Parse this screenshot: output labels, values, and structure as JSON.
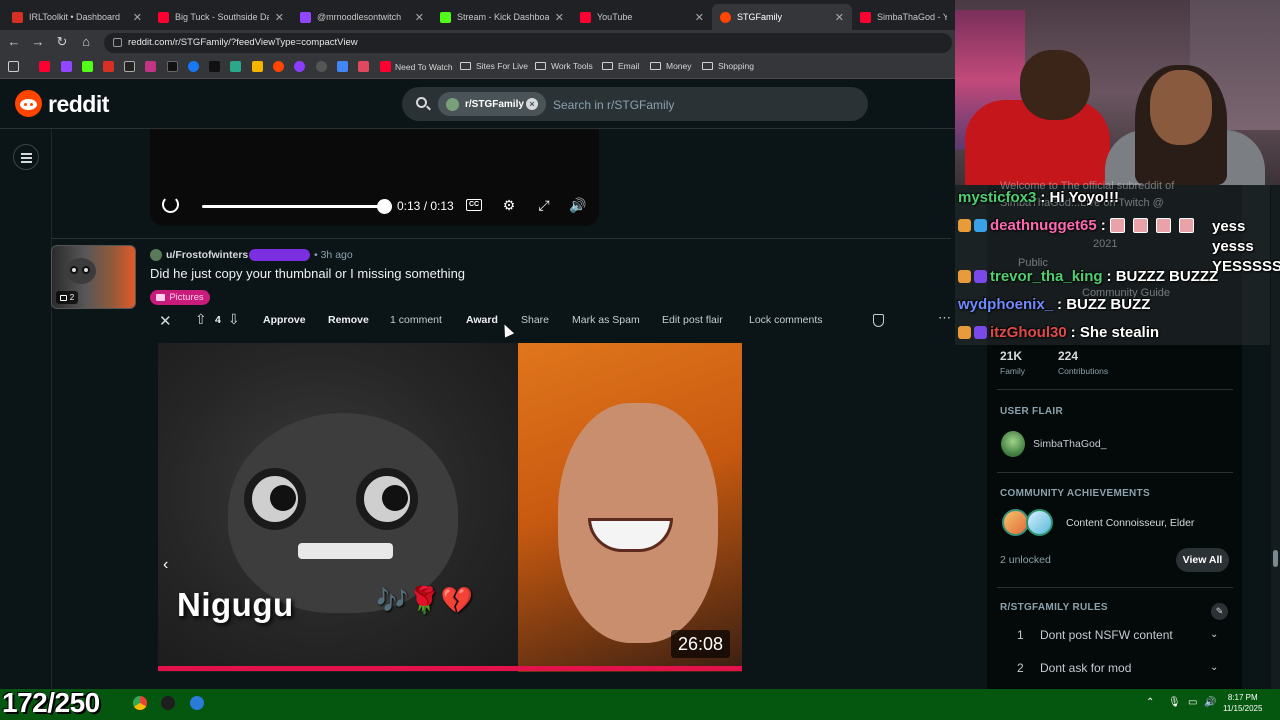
{
  "browser": {
    "tabs": [
      {
        "label": "IRLToolkit • Dashboard",
        "color": "#d93025"
      },
      {
        "label": "Big Tuck - Southside Da Rea",
        "color": "#ff0033"
      },
      {
        "label": "@mrnoodlesontwitch",
        "color": "#9146ff"
      },
      {
        "label": "Stream - Kick Dashboard",
        "color": "#53fc18"
      },
      {
        "label": "YouTube",
        "color": "#ff0033"
      },
      {
        "label": "STGFamily",
        "color": "#ff4500"
      },
      {
        "label": "SimbaThaGod - YouTube",
        "color": "#ff0033"
      }
    ],
    "url": "reddit.com/r/STGFamily/?feedViewType=compactView",
    "bookmarks": {
      "folders": [
        "Need To Watch",
        "Sites For Live",
        "Work Tools",
        "Email",
        "Money",
        "Shopping"
      ]
    }
  },
  "reddit": {
    "wordmark": "reddit",
    "search_chip": "r/STGFamily",
    "search_placeholder": "Search in r/STGFamily"
  },
  "player": {
    "time": "0:13 / 0:13",
    "progress_fraction": 1.0,
    "cc_label": "CC"
  },
  "post": {
    "username": "u/Frostofwinters",
    "user_flair": "",
    "time": "• 3h ago",
    "title": "Did he just copy your thumbnail or I missing something",
    "flair": "Pictures",
    "gallery_count": "2",
    "score": "4",
    "actions": {
      "approve": "Approve",
      "remove": "Remove",
      "comments": "1 comment",
      "award": "Award",
      "share": "Share",
      "spam": "Mark as Spam",
      "edit_flair": "Edit post flair",
      "lock": "Lock comments"
    },
    "image_text": "Nigugu",
    "image_emojis": "🎶🌹💔",
    "image_duration": "26:08"
  },
  "sidebar": {
    "family_count": "21K",
    "family_label": "Family",
    "contrib_count": "224",
    "contrib_label": "Contributions",
    "user_flair_head": "USER FLAIR",
    "user_flair_name": "SimbaThaGod_",
    "achievements_head": "COMMUNITY ACHIEVEMENTS",
    "achievements_text": "Content Connoisseur, Elder",
    "unlocked": "2 unlocked",
    "view_all": "View All",
    "rules_head": "R/STGFAMILY RULES",
    "rules": [
      {
        "num": "1",
        "text": "Dont post NSFW content"
      },
      {
        "num": "2",
        "text": "Dont ask for mod"
      }
    ]
  },
  "overlay": {
    "ghost": {
      "welcome": "Welcome to The official subreddit of",
      "welcome2": "SimbaThaGod...Live on Twitch @",
      "year": "2021",
      "public": "Public",
      "guide": "Community Guide"
    },
    "chat": [
      {
        "user": "mysticfox3",
        "color": "#4fcf6f",
        "sep": ":",
        "msg": "Hi Yoyo!!!"
      },
      {
        "user": "deathnugget65",
        "color": "#ff69b4",
        "sep": ":",
        "msg": "yess yesss YESSSSSSS"
      },
      {
        "user": "trevor_tha_king",
        "color": "#4fcf6f",
        "sep": ":",
        "msg": "BUZZZ BUZZZ"
      },
      {
        "user": "wydphoenix_",
        "color": "#6f8bff",
        "sep": ":",
        "msg": "BUZZ BUZZ"
      },
      {
        "user": "itzGhoul30",
        "color": "#e24a4a",
        "sep": ":",
        "msg": "She stealin"
      }
    ]
  },
  "stream_counter": "172/250",
  "clock": {
    "time": "8:17 PM",
    "date": "11/15/2025"
  }
}
